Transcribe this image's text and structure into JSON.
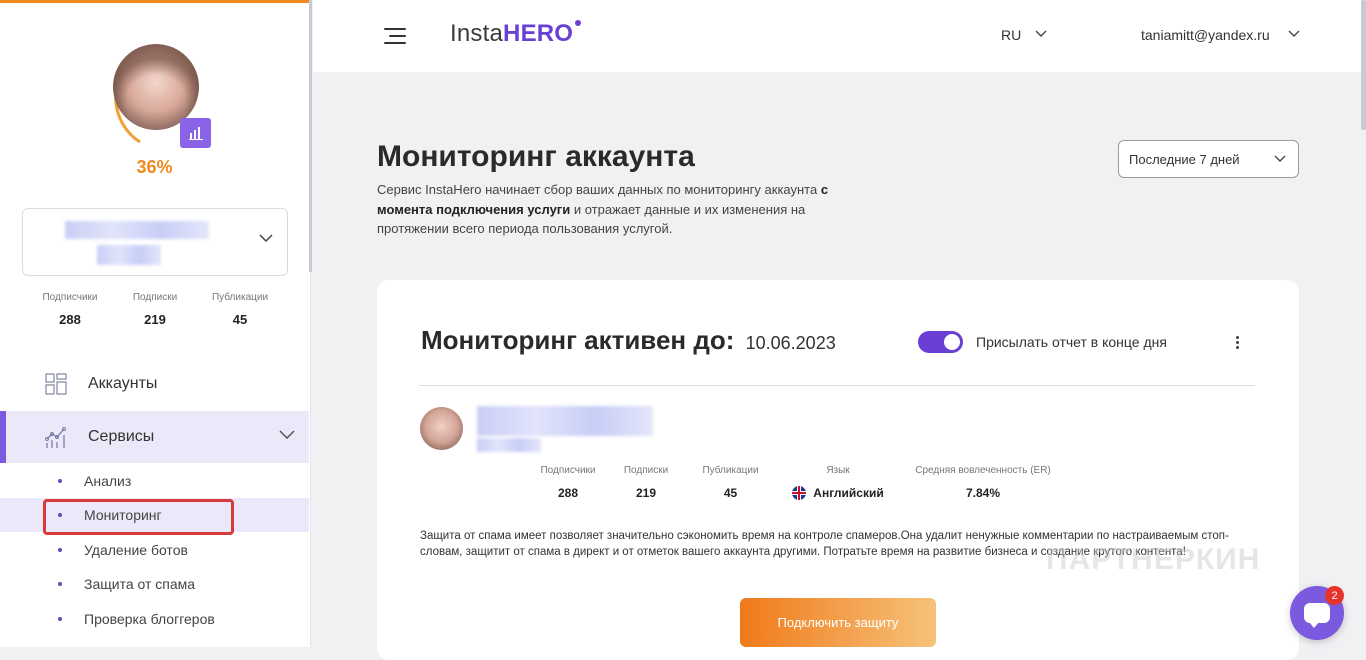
{
  "sidebar": {
    "profile_percent": "36%",
    "progress": 0.36,
    "account_name": "",
    "stats": [
      {
        "label": "Подписчики",
        "value": "288"
      },
      {
        "label": "Подписки",
        "value": "219"
      },
      {
        "label": "Публикации",
        "value": "45"
      }
    ],
    "nav": {
      "accounts": "Аккаунты",
      "services": "Сервисы"
    },
    "sub_items": [
      "Анализ",
      "Мониторинг",
      "Удаление ботов",
      "Защита от спама",
      "Проверка блоггеров"
    ]
  },
  "header": {
    "logo_insta": "Insta",
    "logo_hero": "HERO",
    "language": "RU",
    "email": "taniamitt@yandex.ru"
  },
  "page": {
    "title": "Мониторинг аккаунта",
    "desc_part1": "Сервис InstaHero начинает сбор ваших данных по мониторингу аккаунта ",
    "desc_bold": "с момента подключения услуги",
    "desc_part2": " и отражает данные и их изменения на протяжении всего периода пользования услугой.",
    "period": "Последние 7 дней"
  },
  "card": {
    "title": "Мониторинг активен до:",
    "date": "10.06.2023",
    "toggle_label": "Присылать отчет в конце дня",
    "toggle_on": true,
    "stats": [
      {
        "label": "Подписчики",
        "value": "288"
      },
      {
        "label": "Подписки",
        "value": "219"
      },
      {
        "label": "Публикации",
        "value": "45"
      },
      {
        "label": "Язык",
        "value": "Английский"
      },
      {
        "label": "Средняя вовлеченность (ER)",
        "value": "7.84%"
      }
    ],
    "text": "Защита от спама имеет позволяет значительно сэкономить время на контроле спамеров.Она удалит ненужные комментарии по настраиваемым стоп-словам, защитит от спама в директ и от отметок вашего аккаунта другими. Потратьте время на развитие бизнеса и создание крутого контента!",
    "cta": "Подключить защиту"
  },
  "watermark": "ПАРТНЕРКИН",
  "chat": {
    "badge": "2"
  },
  "colors": {
    "accent": "#6a3fd3",
    "orange": "#f08a1e",
    "highlight": "#d83a3a"
  }
}
